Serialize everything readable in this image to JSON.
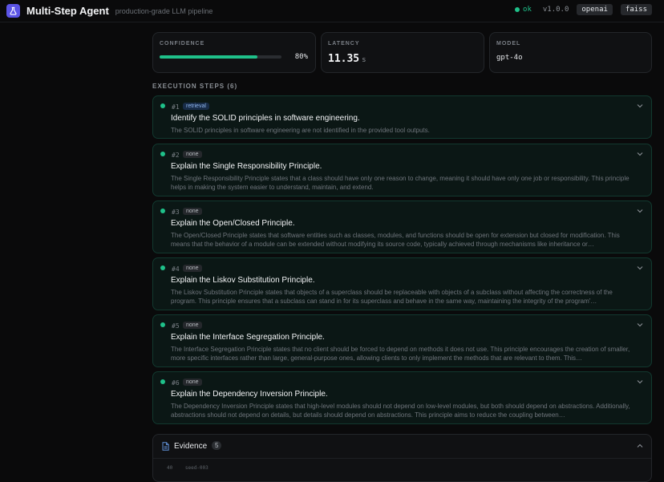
{
  "header": {
    "title": "Multi-Step Agent",
    "subtitle": "production-grade LLM pipeline",
    "status": "ok",
    "version": "v1.0.0",
    "pills": [
      "openai",
      "faiss"
    ],
    "icon": "flask-icon"
  },
  "metrics": {
    "confidence": {
      "label": "CONFIDENCE",
      "value_text": "80%",
      "value": 0.8
    },
    "latency": {
      "label": "LATENCY",
      "value": "11.35",
      "unit": "s"
    },
    "model": {
      "label": "MODEL",
      "value": "gpt-4o"
    }
  },
  "steps_heading": "EXECUTION STEPS (6)",
  "steps": [
    {
      "num": "#1",
      "tag": "retrieval",
      "title": "Identify the SOLID principles in software engineering.",
      "desc": "The SOLID principles in software engineering are not identified in the provided tool outputs."
    },
    {
      "num": "#2",
      "tag": "none",
      "title": "Explain the Single Responsibility Principle.",
      "desc": "The Single Responsibility Principle states that a class should have only one reason to change, meaning it should have only one job or responsibility. This principle helps in making the system easier to understand, maintain, and extend."
    },
    {
      "num": "#3",
      "tag": "none",
      "title": "Explain the Open/Closed Principle.",
      "desc": "The Open/Closed Principle states that software entities such as classes, modules, and functions should be open for extension but closed for modification. This means that the behavior of a module can be extended without modifying its source code, typically achieved through mechanisms like inheritance or…"
    },
    {
      "num": "#4",
      "tag": "none",
      "title": "Explain the Liskov Substitution Principle.",
      "desc": "The Liskov Substitution Principle states that objects of a superclass should be replaceable with objects of a subclass without affecting the correctness of the program. This principle ensures that a subclass can stand in for its superclass and behave in the same way, maintaining the integrity of the program'…"
    },
    {
      "num": "#5",
      "tag": "none",
      "title": "Explain the Interface Segregation Principle.",
      "desc": "The Interface Segregation Principle states that no client should be forced to depend on methods it does not use. This principle encourages the creation of smaller, more specific interfaces rather than large, general-purpose ones, allowing clients to only implement the methods that are relevant to them. This…"
    },
    {
      "num": "#6",
      "tag": "none",
      "title": "Explain the Dependency Inversion Principle.",
      "desc": "The Dependency Inversion Principle states that high-level modules should not depend on low-level modules, but both should depend on abstractions. Additionally, abstractions should not depend on details, but details should depend on abstractions. This principle aims to reduce the coupling between…"
    }
  ],
  "evidence": {
    "title": "Evidence",
    "count": "5",
    "first_row": {
      "score": "40",
      "id": "seed-003"
    }
  }
}
